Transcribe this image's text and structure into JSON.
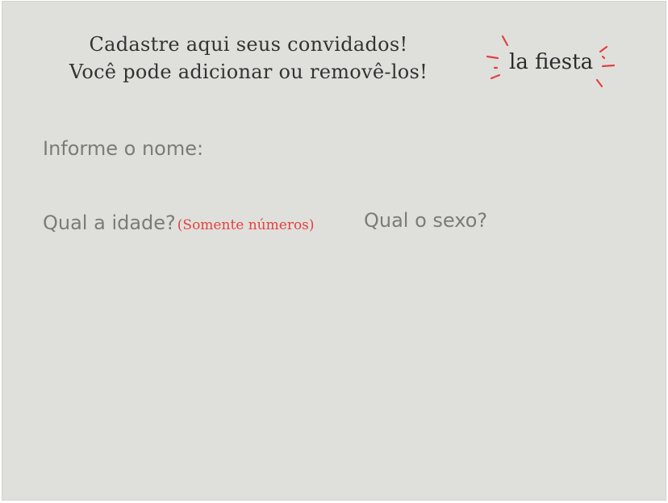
{
  "header": {
    "line1": "Cadastre aqui seus convidados!",
    "line2": "Você pode adicionar ou removê-los!"
  },
  "logo": {
    "text": "la fiesta",
    "icon": "sparkle-burst-icon",
    "accent_color": "#e5403f"
  },
  "form": {
    "name_label": "Informe o nome:",
    "age_label": "Qual a idade?",
    "age_hint": "(Somente números)",
    "sex_label": "Qual o sexo?"
  },
  "colors": {
    "background": "#dfe0dc",
    "label": "#7b7b78",
    "heading": "#333333",
    "hint": "#e5403f"
  }
}
